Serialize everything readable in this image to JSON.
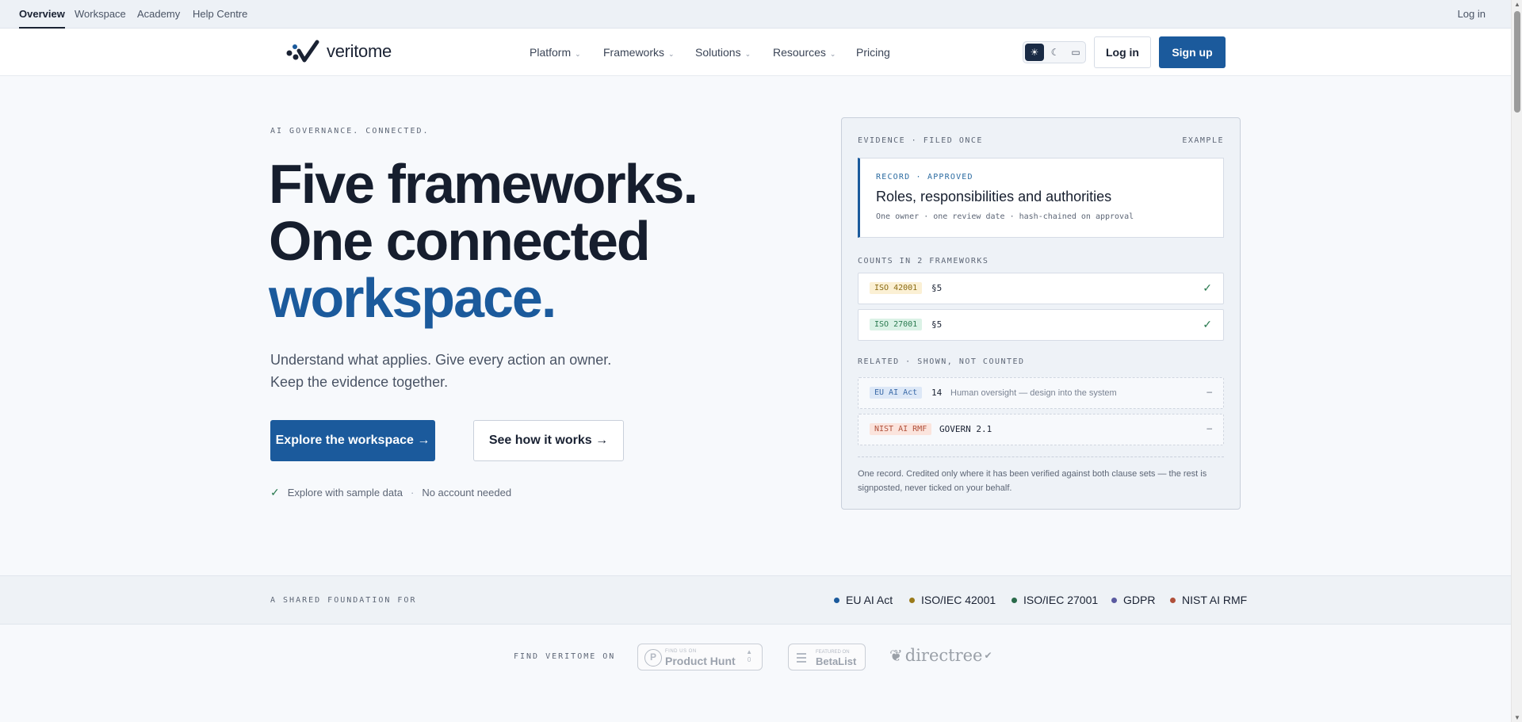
{
  "topbar": {
    "tabs": [
      "Overview",
      "Workspace",
      "Academy",
      "Help Centre"
    ],
    "login": "Log in"
  },
  "nav": {
    "brand": "veritome",
    "menu": [
      "Platform",
      "Frameworks",
      "Solutions",
      "Resources",
      "Pricing"
    ],
    "login": "Log in",
    "signup": "Sign up"
  },
  "hero": {
    "eyebrow": "AI GOVERNANCE. CONNECTED.",
    "title_line1": "Five frameworks.",
    "title_line2": "One connected",
    "title_accent": "workspace.",
    "sub_line1": "Understand what applies. Give every action an owner.",
    "sub_line2": "Keep the evidence together.",
    "cta_primary": "Explore the workspace →",
    "cta_secondary": "See how it works →",
    "note_1": "Explore with sample data",
    "note_sep": "·",
    "note_2": "No account needed"
  },
  "card": {
    "header": "EVIDENCE · FILED ONCE",
    "example": "EXAMPLE",
    "record": {
      "kicker": "RECORD · APPROVED",
      "title": "Roles, responsibilities and authorities",
      "meta": "One owner · one review date · hash-chained on approval"
    },
    "counts_label": "COUNTS IN 2 FRAMEWORKS",
    "counts": [
      {
        "badge": "ISO 42001",
        "section": "§5",
        "mark": "✓"
      },
      {
        "badge": "ISO 27001",
        "section": "§5",
        "mark": "✓"
      }
    ],
    "related_label": "RELATED · SHOWN, NOT COUNTED",
    "related": [
      {
        "badge": "EU AI Act",
        "section": "14",
        "desc": "Human oversight — design into the system",
        "mark": "–"
      },
      {
        "badge": "NIST AI RMF",
        "section": "GOVERN 2.1",
        "desc": "",
        "mark": "–"
      }
    ],
    "footnote": "One record. Credited only where it has been verified against both clause sets — the rest is signposted, never ticked on your behalf."
  },
  "strip": {
    "label": "A SHARED FOUNDATION FOR",
    "frameworks": [
      {
        "name": "EU AI Act",
        "color": "#1b5a9c"
      },
      {
        "name": "ISO/IEC 42001",
        "color": "#9a7a1a"
      },
      {
        "name": "ISO/IEC 27001",
        "color": "#2a6a4a"
      },
      {
        "name": "GDPR",
        "color": "#5a5aa0"
      },
      {
        "name": "NIST AI RMF",
        "color": "#b0503a"
      }
    ]
  },
  "find": {
    "label": "FIND VERITOME ON",
    "producthunt_small": "FIND US ON",
    "producthunt": "Product Hunt",
    "producthunt_votes": "0",
    "betalist_small": "FEATURED ON",
    "betalist": "BetaList",
    "directree": "directree"
  }
}
